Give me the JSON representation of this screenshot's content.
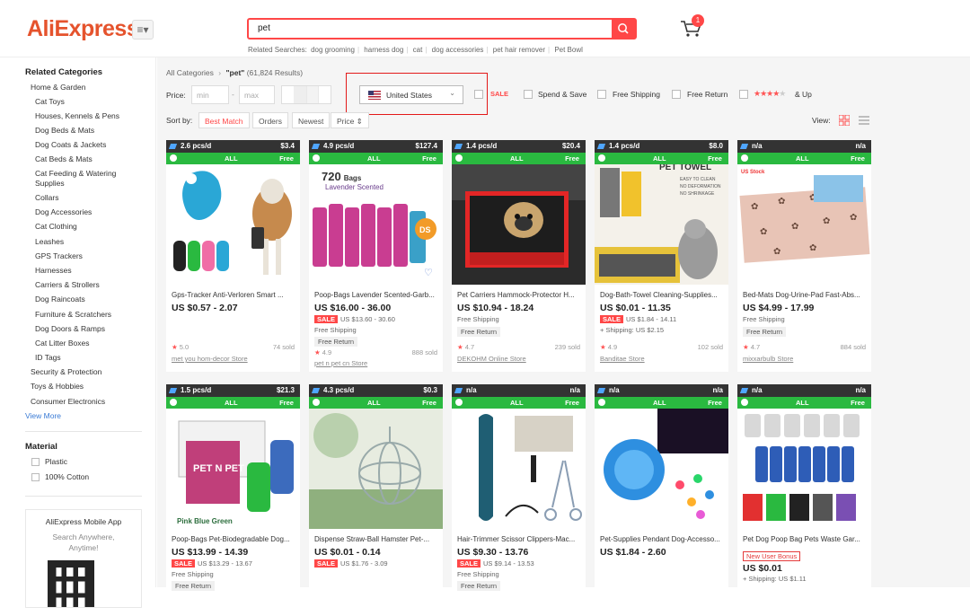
{
  "brand": {
    "logo": "AliExpress",
    "menu_glyph": "≡▾"
  },
  "search": {
    "query": "pet",
    "related_label": "Related Searches:",
    "related": [
      "dog grooming",
      "harness dog",
      "cat",
      "dog accessories",
      "pet hair remover",
      "Pet Bowl"
    ]
  },
  "cart": {
    "count": "1"
  },
  "sidebar": {
    "related_title": "Related Categories",
    "items": [
      "Home & Garden",
      "Cat Toys",
      "Houses, Kennels & Pens",
      "Dog Beds & Mats",
      "Dog Coats & Jackets",
      "Cat Beds & Mats",
      "Cat Feeding & Watering",
      "Supplies",
      "Collars",
      "Dog Accessories",
      "Cat Clothing",
      "Leashes",
      "GPS Trackers",
      "Harnesses",
      "Carriers & Strollers",
      "Dog Raincoats",
      "Furniture & Scratchers",
      "Dog Doors & Ramps",
      "Cat Litter Boxes",
      "ID Tags",
      "Security & Protection",
      "Toys & Hobbies",
      "Consumer Electronics"
    ],
    "view_more": "View More",
    "material_title": "Material",
    "materials": [
      "Plastic",
      "100% Cotton"
    ],
    "app_title": "AliExpress Mobile App",
    "app_sub1": "Search Anywhere,",
    "app_sub2": "Anytime!"
  },
  "breadcrumb": {
    "all": "All Categories",
    "sep": "›",
    "term": "\"pet\"",
    "count": "(61,824 Results)"
  },
  "filters": {
    "price_label": "Price:",
    "min": "min",
    "max": "max",
    "country": "United States",
    "sale": "SALE",
    "spend_save": "Spend & Save",
    "free_shipping": "Free Shipping",
    "free_return": "Free Return",
    "and_up": "& Up"
  },
  "sort": {
    "label": "Sort by:",
    "best": "Best Match",
    "orders": "Orders",
    "newest": "Newest",
    "price": "Price ⇕",
    "view": "View:"
  },
  "products": [
    {
      "rate": "2.6 pcs/d",
      "hdr_r": "$3.4",
      "all": "ALL",
      "free": "Free",
      "title": "Gps-Tracker Anti-Verloren Smart ...",
      "price": "US $0.57 - 2.07",
      "line2": "",
      "line3": "",
      "rating": "5.0",
      "sold": "74 sold",
      "store": "met you hom-decor Store"
    },
    {
      "rate": "4.9 pcs/d",
      "hdr_r": "$127.4",
      "all": "ALL",
      "free": "Free",
      "title": "Poop-Bags Lavender Scented-Garb...",
      "price": "US $16.00 - 36.00",
      "line2": "US $13.60 - 30.60",
      "line3": "Free Shipping",
      "fr": "Free Return",
      "rating": "4.9",
      "sold": "888 sold",
      "store": "pet n pet cn Store"
    },
    {
      "rate": "1.4 pcs/d",
      "hdr_r": "$20.4",
      "all": "ALL",
      "free": "Free",
      "title": "Pet Carriers Hammock-Protector H...",
      "price": "US $10.94 - 18.24",
      "line2": "",
      "line3": "Free Shipping",
      "fr": "Free Return",
      "rating": "4.7",
      "sold": "239 sold",
      "store": "DEKOHM Online Store"
    },
    {
      "rate": "1.4 pcs/d",
      "hdr_r": "$8.0",
      "all": "ALL",
      "free": "Free",
      "title": "Dog-Bath-Towel Cleaning-Supplies...",
      "price": "US $0.01 - 11.35",
      "line2": "US $1.84 - 14.11",
      "line3": "+ Shipping: US $2.15",
      "rating": "4.9",
      "sold": "102 sold",
      "store": "Banditae Store"
    },
    {
      "rate": "n/a",
      "hdr_r": "n/a",
      "all": "ALL",
      "free": "Free",
      "title": "Bed-Mats Dog-Urine-Pad Fast-Abs...",
      "price": "US $4.99 - 17.99",
      "line2": "",
      "line3": "Free Shipping",
      "fr": "Free Return",
      "rating": "4.7",
      "sold": "884 sold",
      "store": "mixxarbulb Store"
    },
    {
      "rate": "1.5 pcs/d",
      "hdr_r": "$21.3",
      "all": "ALL",
      "free": "Free",
      "title": "Poop-Bags Pet-Biodegradable Dog...",
      "price": "US $13.99 - 14.39",
      "line2": "US $13.29 - 13.67",
      "line3": "Free Shipping",
      "fr": "Free Return"
    },
    {
      "rate": "4.3 pcs/d",
      "hdr_r": "$0.3",
      "all": "ALL",
      "free": "Free",
      "title": "Dispense Straw-Ball Hamster Pet-...",
      "price": "US $0.01 - 0.14",
      "line2": "US $1.76 - 3.09"
    },
    {
      "rate": "n/a",
      "hdr_r": "n/a",
      "all": "ALL",
      "free": "Free",
      "title": "Hair-Trimmer Scissor Clippers-Mac...",
      "price": "US $9.30 - 13.76",
      "line2": "US $9.14 - 13.53",
      "line3": "Free Shipping",
      "fr": "Free Return"
    },
    {
      "rate": "n/a",
      "hdr_r": "n/a",
      "all": "ALL",
      "free": "Free",
      "title": "Pet-Supplies Pendant Dog-Accesso...",
      "price": "US $1.84 - 2.60"
    },
    {
      "rate": "n/a",
      "hdr_r": "n/a",
      "all": "ALL",
      "free": "Free",
      "title": "Pet Dog Poop Bag Pets Waste Gar...",
      "nub": "New User Bonus",
      "price": "US $0.01",
      "line3": "+ Shipping: US $1.11"
    }
  ],
  "labels": {
    "sale_tag": "SALE",
    "star": "★"
  },
  "img_text": {
    "bags_count": "720",
    "bags_word": "Bags",
    "lavender": "Lavender Scented",
    "ds": "DS",
    "towel": "PET TOWEL",
    "towel_lines": [
      "EASY TO CLEAN",
      "NO DEFORMATION",
      "NO SHRINKAGE"
    ],
    "stock": "US Stock",
    "pink_blue": "Pink Blue Green",
    "box": "PET N PET"
  }
}
